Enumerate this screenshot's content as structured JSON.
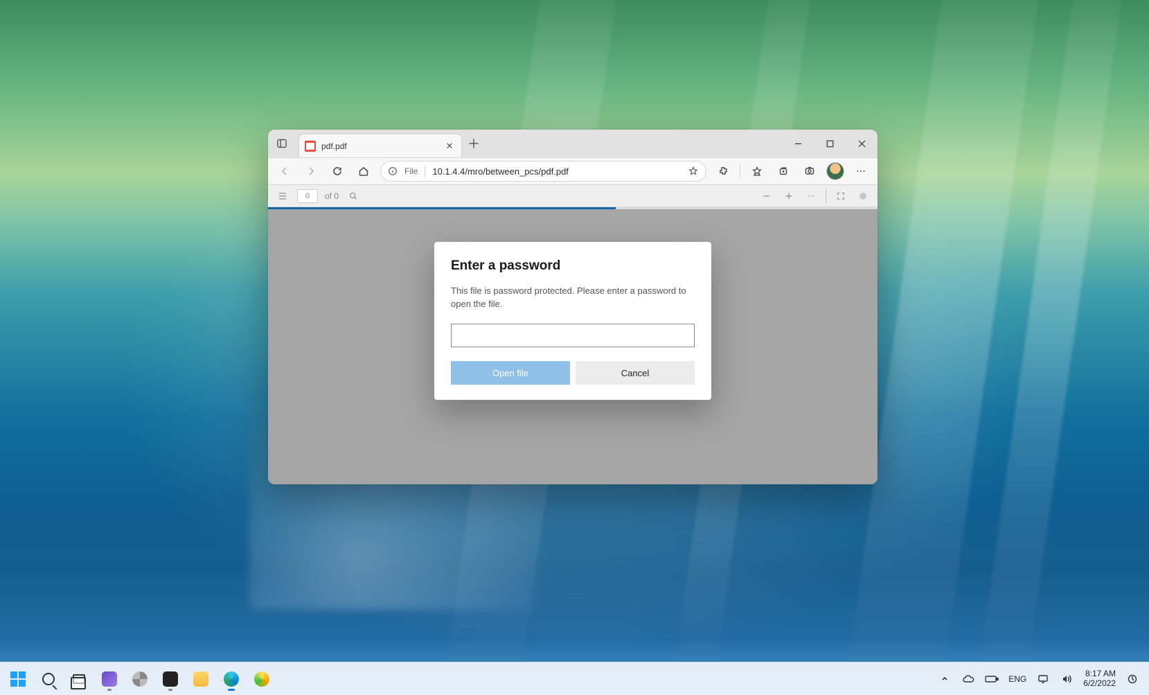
{
  "browser": {
    "tab_title": "pdf.pdf",
    "address_scheme": "File",
    "address_url": "10.1.4.4/mro/between_pcs/pdf.pdf"
  },
  "pdf_toolbar": {
    "page_current": "0",
    "page_total": "of 0",
    "progress_percent": 57
  },
  "dialog": {
    "title": "Enter a password",
    "message": "This file is password protected. Please enter a password to open the file.",
    "open_label": "Open file",
    "cancel_label": "Cancel",
    "password_value": ""
  },
  "system_tray": {
    "language": "ENG",
    "time": "8:17 AM",
    "date": "6/2/2022"
  }
}
